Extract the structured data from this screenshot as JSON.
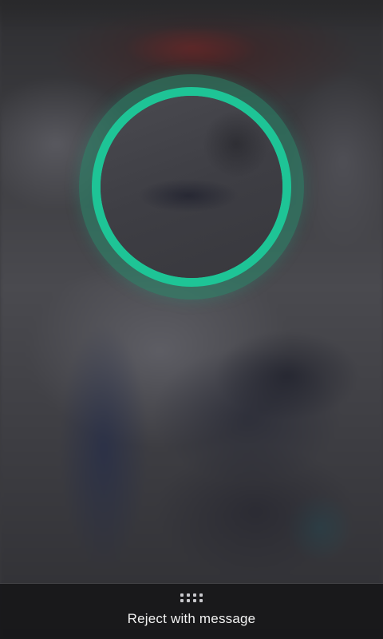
{
  "incoming_call": {
    "answer_ring": {
      "icon": "circle-ring-icon",
      "accent_color": "#1ec496"
    },
    "reject_bar": {
      "handle_icon": "drag-handle-icon",
      "label": "Reject with message"
    }
  }
}
